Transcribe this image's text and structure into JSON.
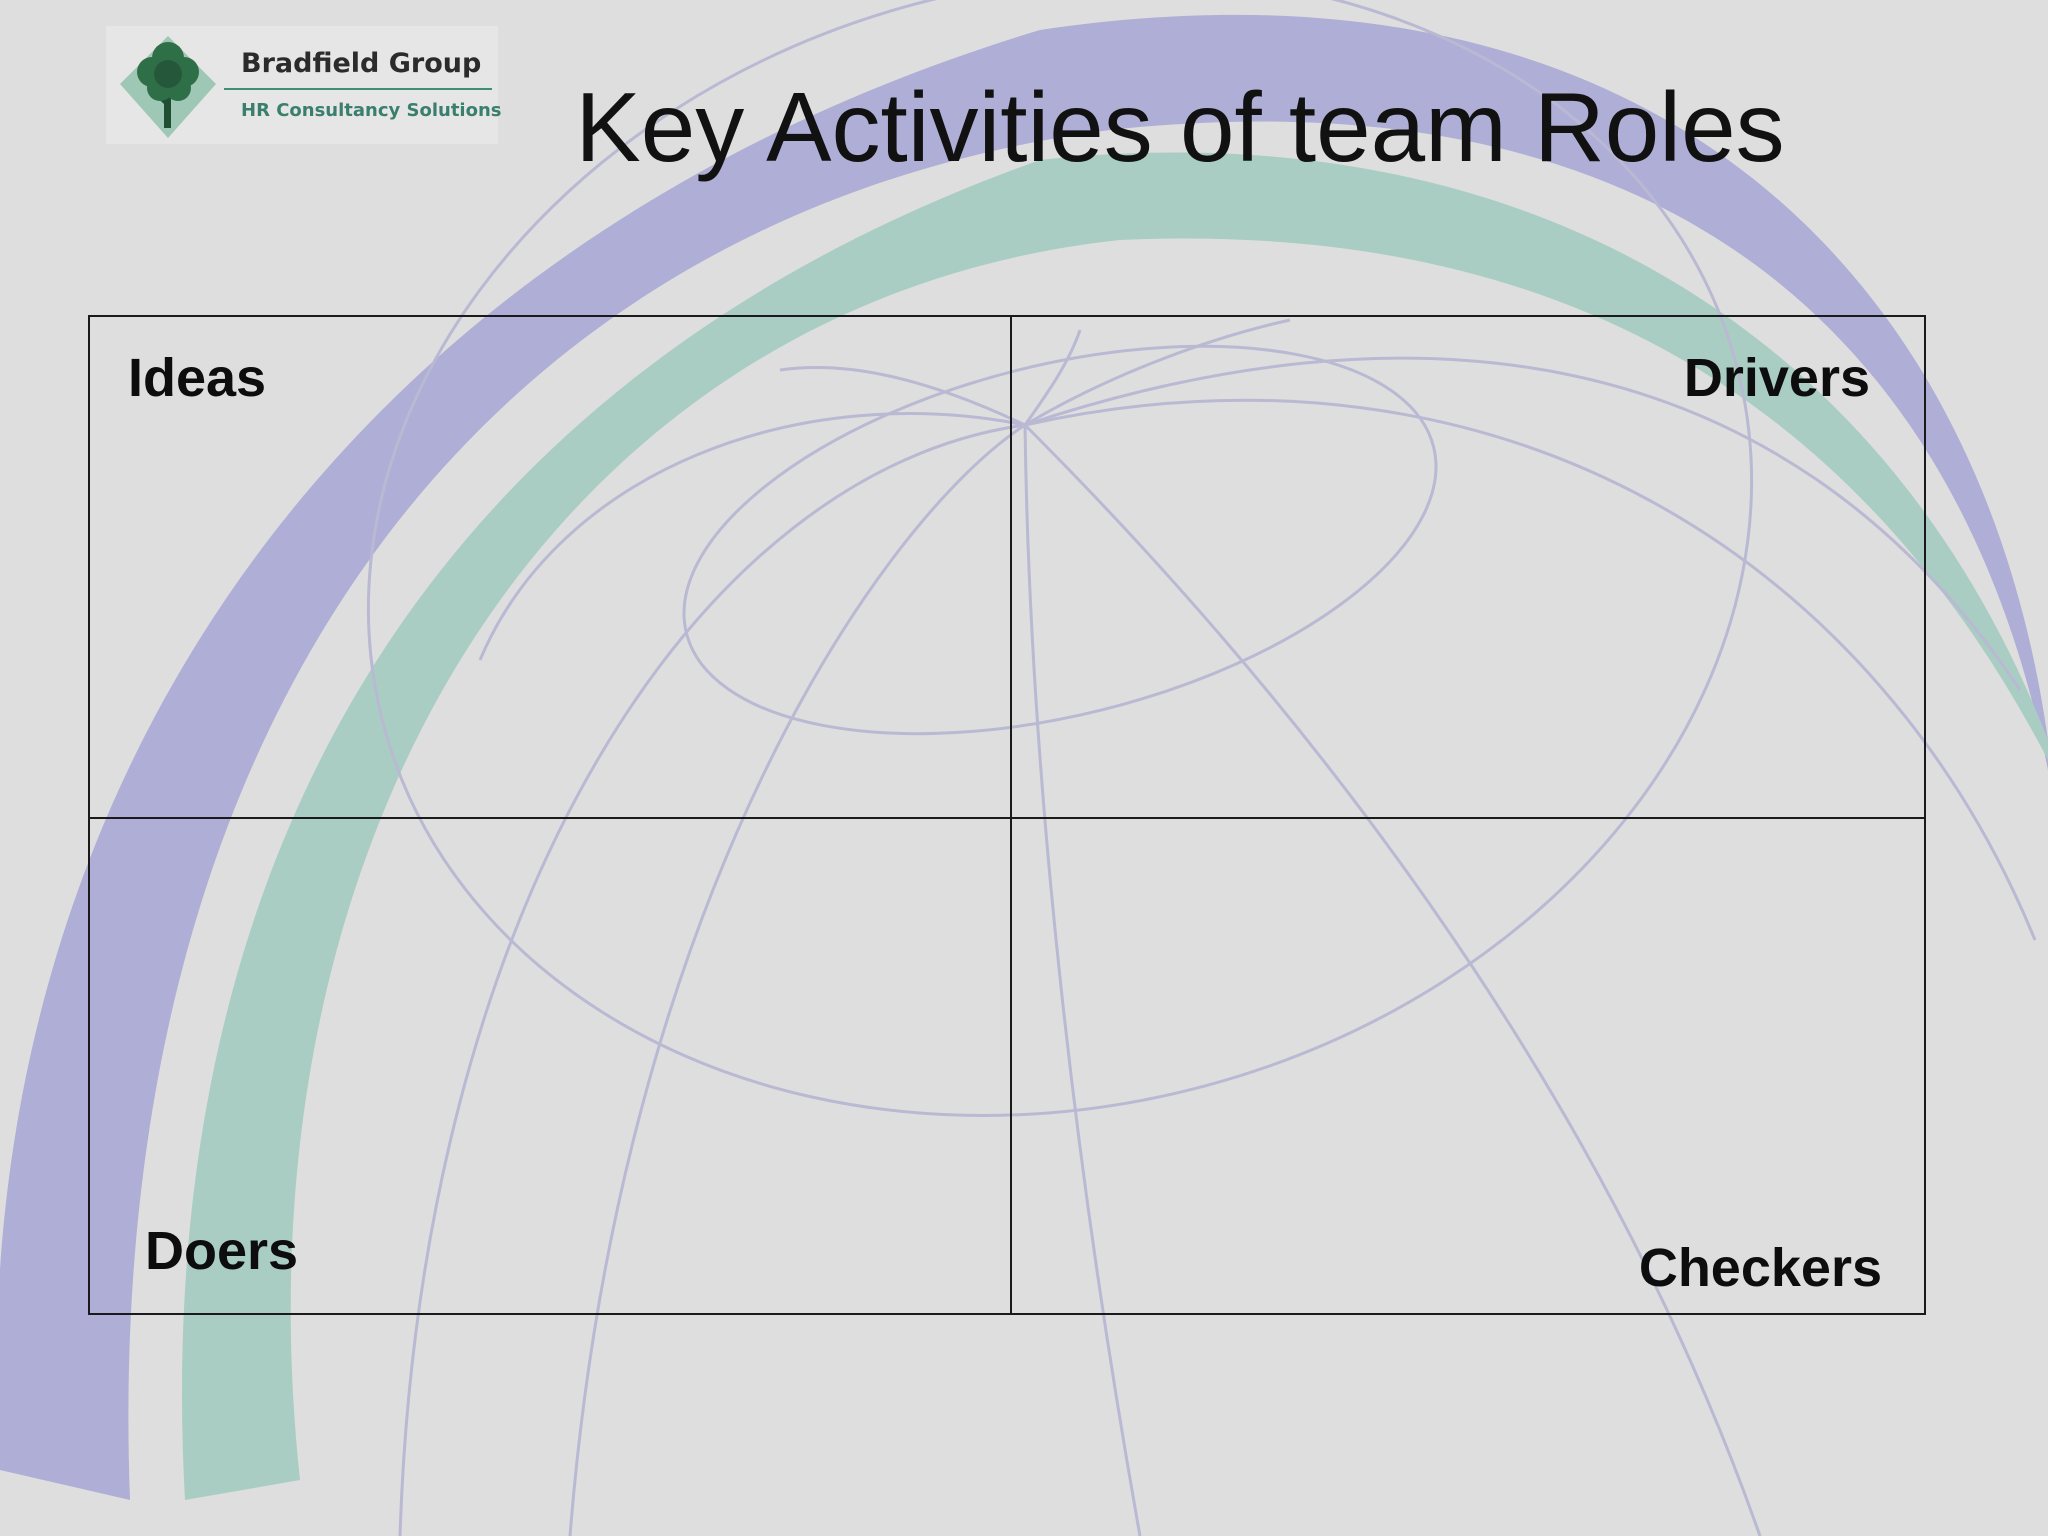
{
  "logo": {
    "company": "Bradfield Group",
    "tagline": "HR Consultancy Solutions",
    "icon": "tree-icon"
  },
  "slide": {
    "title": "Key Activities of team Roles"
  },
  "quadrants": {
    "top_left": "Ideas",
    "top_right": "Drivers",
    "bottom_left": "Doers",
    "bottom_right": "Checkers"
  },
  "colors": {
    "background": "#dedede",
    "arc_purple": "#aeaed6",
    "arc_green": "#a9cdc3",
    "globe_lines": "#b9b9d3",
    "logo_green": "#2f6f48"
  }
}
